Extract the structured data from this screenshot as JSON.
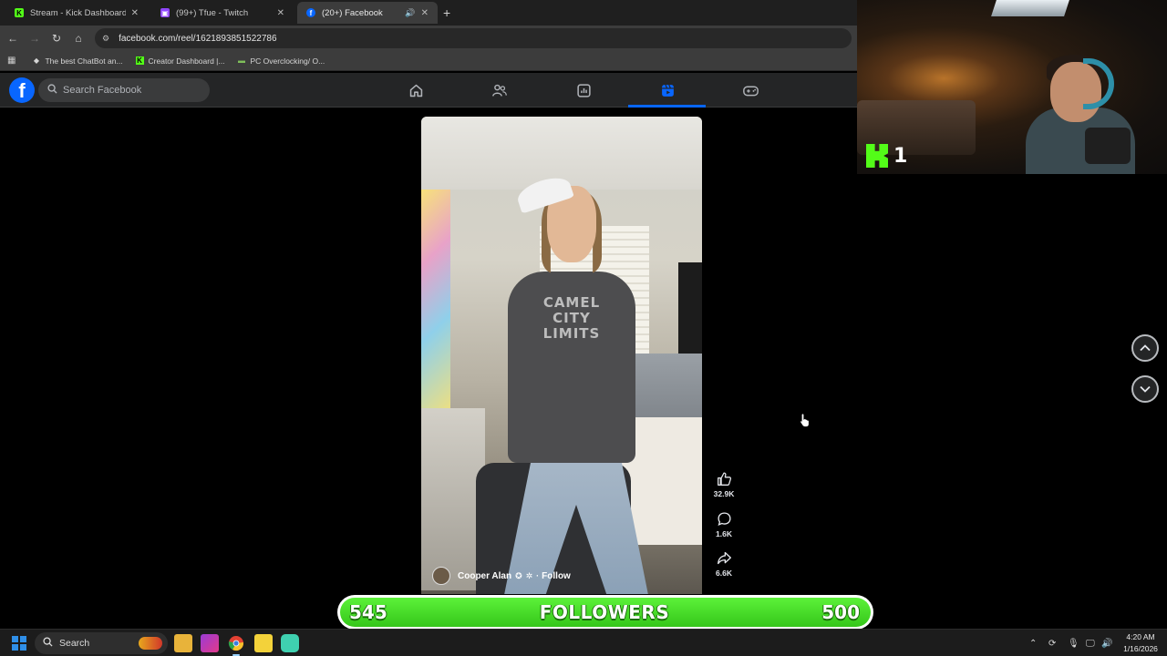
{
  "browser": {
    "tabs": [
      {
        "title": "Stream - Kick Dashboard",
        "icon": "kick-icon",
        "active": false
      },
      {
        "title": "(99+) Tfue - Twitch",
        "icon": "twitch-icon",
        "active": false
      },
      {
        "title": "(20+) Facebook",
        "icon": "facebook-icon",
        "active": true
      }
    ],
    "url": "facebook.com/reel/1621893851522786",
    "bookmarks": [
      {
        "label": "The best ChatBot an...",
        "icon": "chatbot-icon"
      },
      {
        "label": "Creator Dashboard |...",
        "icon": "kick-icon"
      },
      {
        "label": "PC Overclocking/ O...",
        "icon": "pc-icon"
      }
    ]
  },
  "facebook": {
    "search_placeholder": "Search Facebook",
    "nav": [
      "home-icon",
      "friends-icon",
      "dashboard-icon",
      "reels-icon",
      "gaming-icon"
    ],
    "active_nav": "reels-icon",
    "accent": "#0866ff"
  },
  "reel": {
    "creator_name": "Cooper Alan",
    "follow_label": "Follow",
    "separator": "·",
    "shirt_text": [
      "CAMEL",
      "CITY",
      "LIMITS"
    ],
    "likes": "32.9K",
    "comments": "1.6K",
    "shares": "6.6K"
  },
  "stream_overlay": {
    "kick_viewers": "1",
    "followers_current": "545",
    "followers_label": "FOLLOWERS",
    "followers_goal": "500",
    "bar_color": "#35c61a"
  },
  "taskbar": {
    "search_label": "Search",
    "time": "4:20 AM",
    "date": "1/16/2026"
  }
}
